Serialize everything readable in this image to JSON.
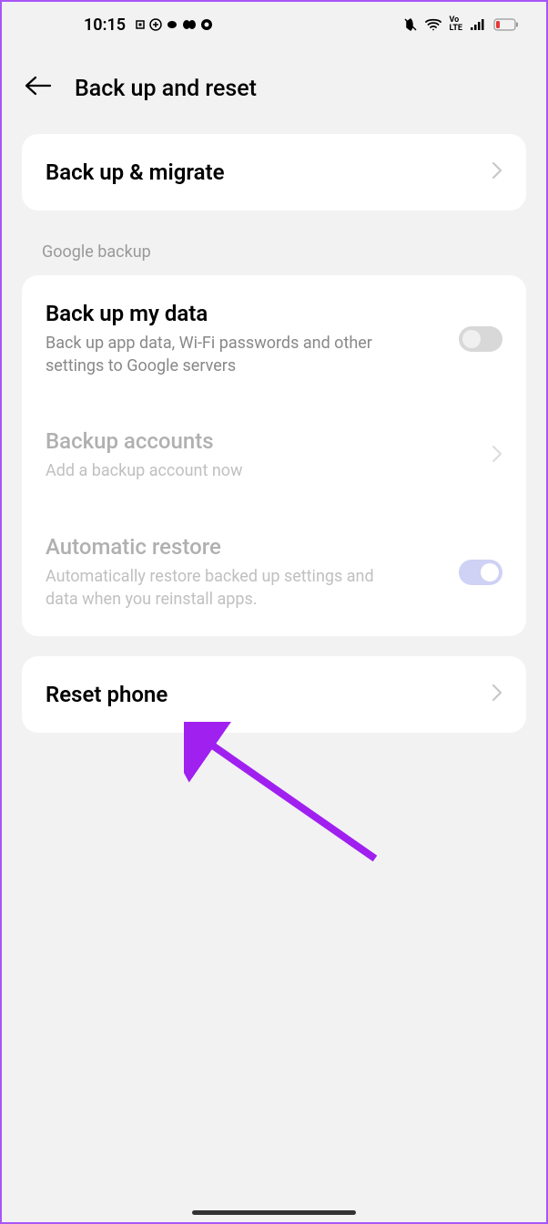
{
  "status_bar": {
    "time": "10:15"
  },
  "header": {
    "title": "Back up and reset"
  },
  "backup_migrate": {
    "title": "Back up & migrate"
  },
  "section_label": "Google backup",
  "backup_my_data": {
    "title": "Back up my data",
    "subtitle": "Back up app data, Wi-Fi passwords and other settings to Google servers"
  },
  "backup_accounts": {
    "title": "Backup accounts",
    "subtitle": "Add a backup account now"
  },
  "automatic_restore": {
    "title": "Automatic restore",
    "subtitle": "Automatically restore backed up settings and data when you reinstall apps."
  },
  "reset_phone": {
    "title": "Reset phone"
  }
}
